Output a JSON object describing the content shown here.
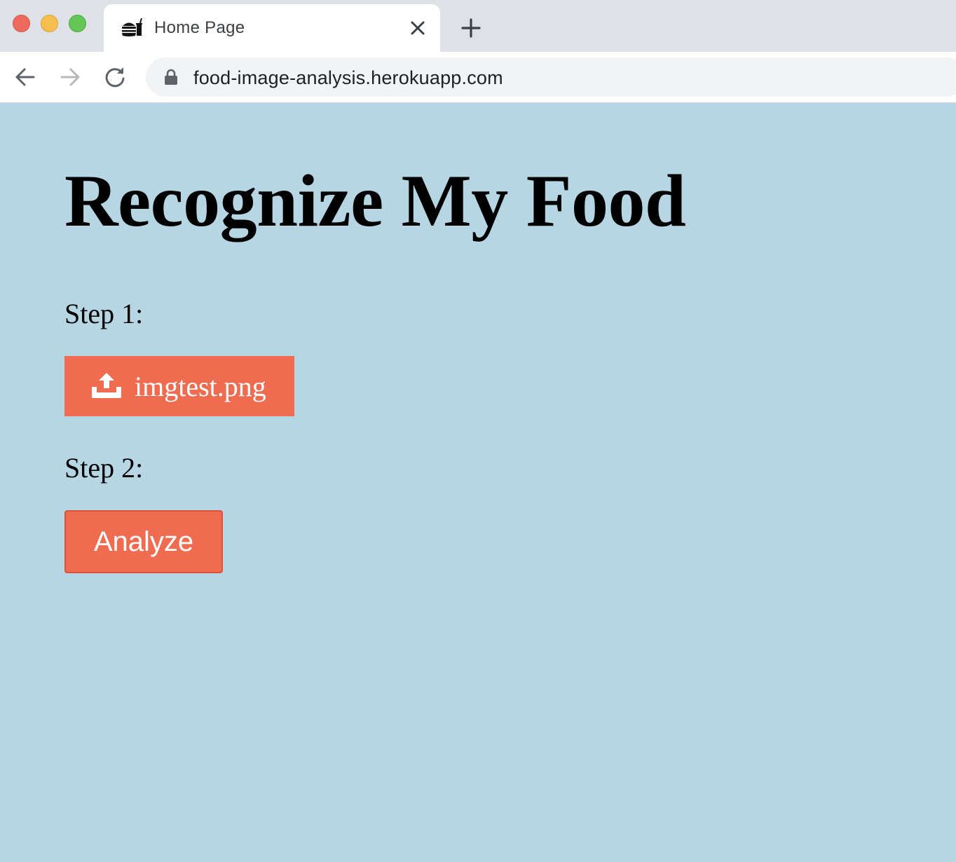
{
  "browser": {
    "tab": {
      "title": "Home Page",
      "favicon": "food-burger-drink-icon"
    },
    "new_tab_icon": "plus-icon",
    "address_bar": {
      "url": "food-image-analysis.herokuapp.com",
      "secure_icon": "lock-icon"
    },
    "nav": {
      "back": "back-arrow-icon",
      "forward": "forward-arrow-icon",
      "reload": "reload-icon"
    }
  },
  "page": {
    "title": "Recognize My Food",
    "step1_label": "Step 1:",
    "upload_button": {
      "icon": "upload-icon",
      "label": "imgtest.png"
    },
    "step2_label": "Step 2:",
    "analyze_button": {
      "label": "Analyze"
    }
  },
  "colors": {
    "background": "#b5d6e2",
    "button": "#ef6c51",
    "button_text": "#ffffff"
  }
}
